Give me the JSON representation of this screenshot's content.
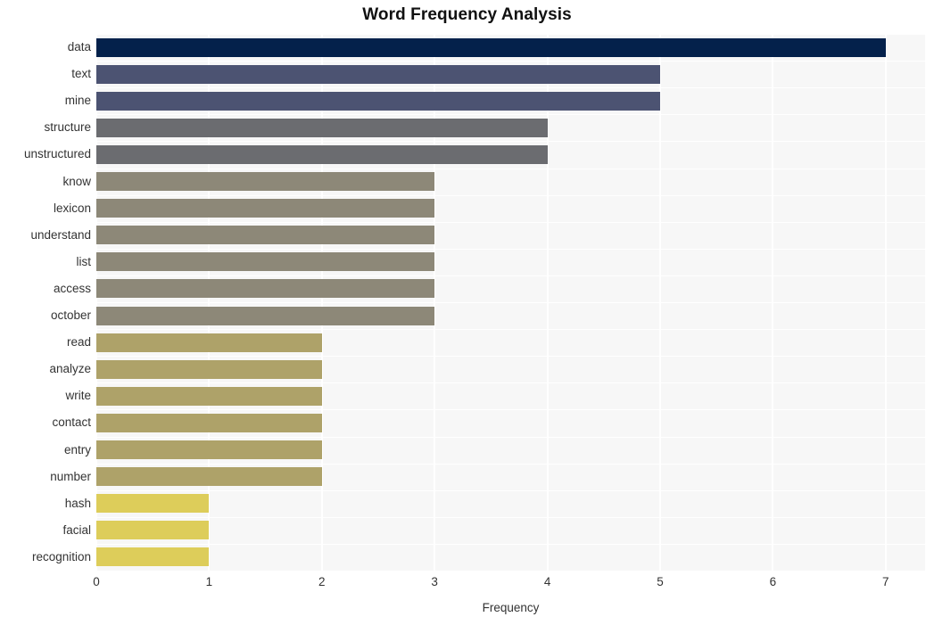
{
  "chart_data": {
    "type": "bar",
    "orientation": "horizontal",
    "title": "Word Frequency Analysis",
    "xlabel": "Frequency",
    "ylabel": "",
    "xlim": [
      0,
      7.35
    ],
    "ylim": null,
    "grid": true,
    "legend": null,
    "xticks": [
      "0",
      "1",
      "2",
      "3",
      "4",
      "5",
      "6",
      "7"
    ],
    "xtick_values": [
      0,
      1,
      2,
      3,
      4,
      5,
      6,
      7
    ],
    "categories": [
      "data",
      "text",
      "mine",
      "structure",
      "unstructured",
      "know",
      "lexicon",
      "understand",
      "list",
      "access",
      "october",
      "read",
      "analyze",
      "write",
      "contact",
      "entry",
      "number",
      "hash",
      "facial",
      "recognition"
    ],
    "values": [
      7,
      5,
      5,
      4,
      4,
      3,
      3,
      3,
      3,
      3,
      3,
      2,
      2,
      2,
      2,
      2,
      2,
      1,
      1,
      1
    ],
    "bar_colors": [
      "#04214b",
      "#4c5372",
      "#4c5372",
      "#6b6c70",
      "#6b6c70",
      "#8d8878",
      "#8d8878",
      "#8d8878",
      "#8d8878",
      "#8d8878",
      "#8d8878",
      "#aea269",
      "#aea269",
      "#aea269",
      "#aea269",
      "#aea269",
      "#aea269",
      "#ddcd5a",
      "#ddcd5a",
      "#ddcd5a"
    ],
    "plot_background": "#f7f7f7",
    "grid_color": "#ffffff",
    "figure_background": "#ffffff"
  }
}
